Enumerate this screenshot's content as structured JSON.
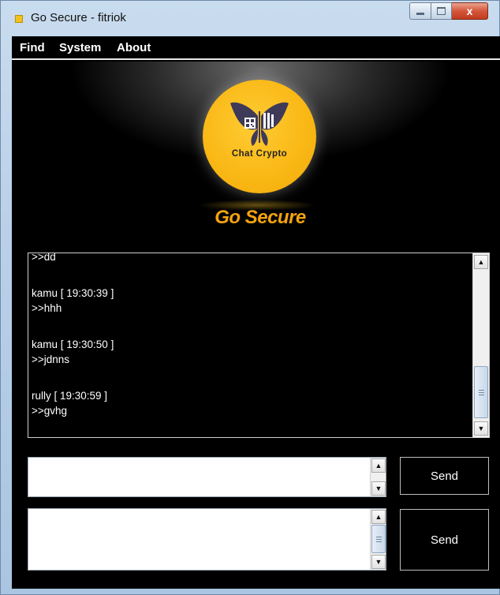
{
  "window": {
    "title": "Go Secure - fitriok",
    "icon": "app-icon",
    "controls": {
      "minimize": "minimize-icon",
      "maximize": "maximize-icon",
      "close": "x"
    }
  },
  "menu": {
    "items": [
      {
        "label": "Find"
      },
      {
        "label": "System"
      },
      {
        "label": "About"
      }
    ]
  },
  "logo": {
    "text": "Chat Crypto",
    "brand": "Go Secure",
    "colors": {
      "circle": "#f9b714",
      "brand_text": "#f3a30f"
    }
  },
  "chat": {
    "partial_line": ">>dd",
    "messages": [
      {
        "header": "kamu [ 19:30:39 ]",
        "body": ">>hhh"
      },
      {
        "header": "kamu [ 19:30:50 ]",
        "body": ">>jdnns"
      },
      {
        "header": "rully [ 19:30:59 ]",
        "body": ">>gvhg"
      }
    ]
  },
  "compose": {
    "input1": {
      "value": "",
      "send_label": "Send"
    },
    "input2": {
      "value": "",
      "send_label": "Send"
    }
  }
}
